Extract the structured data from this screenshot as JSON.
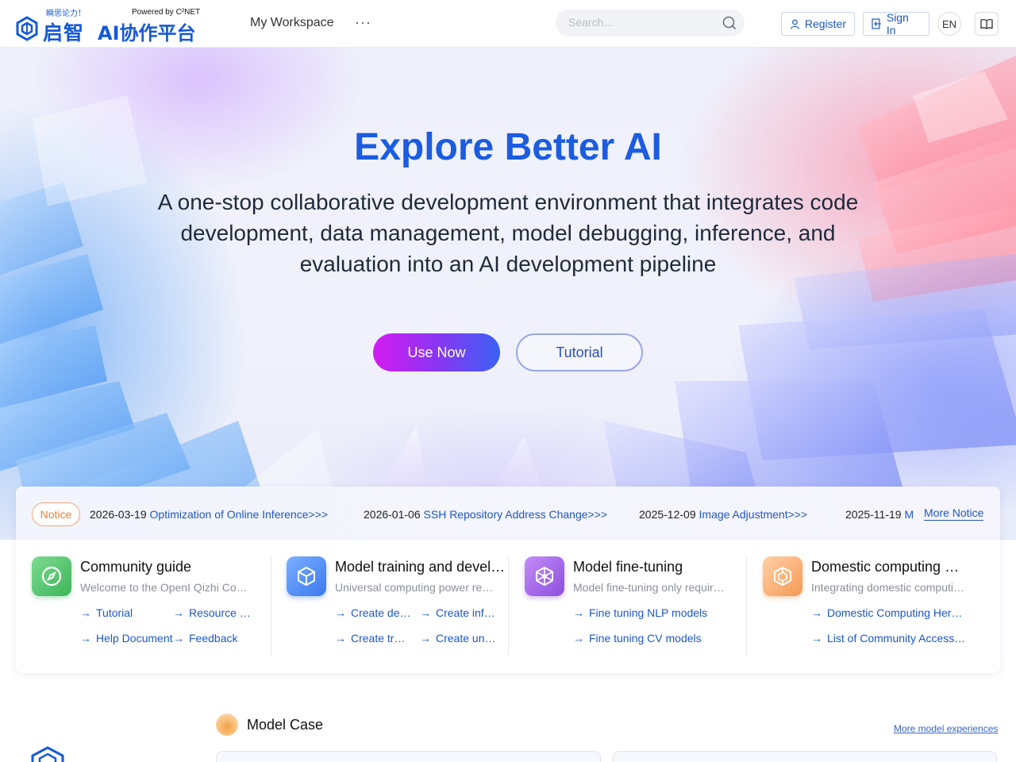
{
  "header": {
    "logo": {
      "slogan": "瞬思论力！",
      "cn_name": "启智",
      "powered_by": "Powered by C²NET",
      "ai_name": "AI协作平台"
    },
    "nav_workspace": "My Workspace",
    "nav_more": "···",
    "search_placeholder": "Search...",
    "register": "Register",
    "sign_in": "Sign In",
    "language": "EN"
  },
  "hero": {
    "title": "Explore Better AI",
    "subtitle": "A one-stop collaborative development environment that integrates code development, data management, model debugging, inference, and evaluation into an AI development pipeline",
    "primary_button": "Use Now",
    "secondary_button": "Tutorial"
  },
  "notice": {
    "tag": "Notice",
    "items": [
      {
        "date": "2026-03-19",
        "title": "Optimization of Online Inference>>>"
      },
      {
        "date": "2026-01-06",
        "title": "SSH Repository Address Change>>>"
      },
      {
        "date": "2025-12-09",
        "title": "Image Adjustment>>>"
      },
      {
        "date": "2025-11-19",
        "title": "M"
      }
    ],
    "more": "More Notice"
  },
  "cards": [
    {
      "icon": "compass-icon",
      "color": "#4cc466",
      "title": "Community guide",
      "desc": "Welcome to the OpenI Qizhi Community",
      "links": [
        "Tutorial",
        "Resource Notice",
        "Help Document",
        "Feedback"
      ]
    },
    {
      "icon": "cube-icon",
      "color": "#3f7ef2",
      "title": "Model training and development",
      "desc": "Universal computing power resources",
      "links": [
        "Create debug task",
        "Create inference task",
        "Create training task",
        "Create universal task"
      ]
    },
    {
      "icon": "network-icon",
      "color": "#9a5ee8",
      "title": "Model fine-tuning",
      "desc": "Model fine-tuning only requires a few steps",
      "links": [
        "Fine tuning NLP models",
        "Fine tuning CV models"
      ]
    },
    {
      "icon": "chip-icon",
      "color": "#f4a25c",
      "title": "Domestic computing power",
      "desc": "Integrating domestic computing power resources",
      "links": [
        "Domestic Computing Hero List",
        "List of Community Access Computing"
      ]
    }
  ],
  "model_case": {
    "title": "Model Case",
    "more": "More model experiences"
  }
}
